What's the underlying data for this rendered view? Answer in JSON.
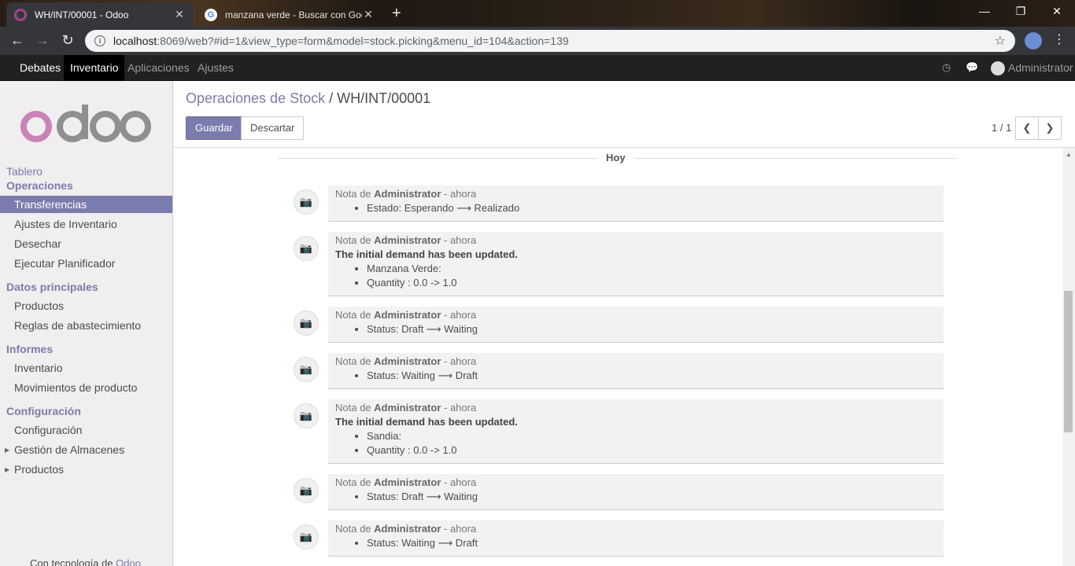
{
  "browser": {
    "tabs": [
      {
        "title": "WH/INT/00001 - Odoo",
        "active": true
      },
      {
        "title": "manzana verde - Buscar con Goo",
        "active": false
      }
    ],
    "url_host": "localhost",
    "url_rest": ":8069/web?#id=1&view_type=form&model=stock.picking&menu_id=104&action=139",
    "window_controls": {
      "minimize": "—",
      "restore": "❐",
      "close": "✕"
    }
  },
  "navbar": {
    "menus": [
      "Debates",
      "Inventario",
      "Aplicaciones",
      "Ajustes"
    ],
    "active_menu": "Inventario",
    "user": "Administrator"
  },
  "sidebar": {
    "logo_text": "odoo",
    "sections": [
      {
        "title": "Tablero"
      },
      {
        "title": "Operaciones",
        "items": [
          "Transferencias",
          "Ajustes de Inventario",
          "Desechar",
          "Ejecutar Planificador"
        ]
      },
      {
        "title": "Datos principales",
        "items": [
          "Productos",
          "Reglas de abastecimiento"
        ]
      },
      {
        "title": "Informes",
        "items": [
          "Inventario",
          "Movimientos de producto"
        ]
      },
      {
        "title": "Configuración",
        "items": [
          "Configuración",
          "Gestión de Almacenes",
          "Productos"
        ]
      }
    ],
    "active_item": "Transferencias",
    "powered_prefix": "Con tecnología de ",
    "powered_brand": "Odoo"
  },
  "control_panel": {
    "breadcrumb_parent": "Operaciones de Stock",
    "breadcrumb_sep": " / ",
    "breadcrumb_current": "WH/INT/00001",
    "save_label": "Guardar",
    "discard_label": "Descartar",
    "pager": "1 / 1"
  },
  "chatter": {
    "date_label": "Hoy",
    "messages": [
      {
        "prefix": "Nota de ",
        "author": "Administrator",
        "time": " - ahora",
        "bullets": [
          "Estado: Esperando ⟶ Realizado"
        ]
      },
      {
        "prefix": "Nota de ",
        "author": "Administrator",
        "time": " - ahora",
        "headline": "The initial demand has been updated.",
        "bullets": [
          "Manzana Verde:",
          "Quantity : 0.0 -> 1.0"
        ]
      },
      {
        "prefix": "Nota de ",
        "author": "Administrator",
        "time": " - ahora",
        "bullets": [
          "Status: Draft ⟶ Waiting"
        ]
      },
      {
        "prefix": "Nota de ",
        "author": "Administrator",
        "time": " - ahora",
        "bullets": [
          "Status: Waiting ⟶ Draft"
        ]
      },
      {
        "prefix": "Nota de ",
        "author": "Administrator",
        "time": " - ahora",
        "headline": "The initial demand has been updated.",
        "bullets": [
          "Sandia:",
          "Quantity : 0.0 -> 1.0"
        ]
      },
      {
        "prefix": "Nota de ",
        "author": "Administrator",
        "time": " - ahora",
        "bullets": [
          "Status: Draft ⟶ Waiting"
        ]
      },
      {
        "prefix": "Nota de ",
        "author": "Administrator",
        "time": " - ahora",
        "bullets": [
          "Status: Waiting ⟶ Draft"
        ]
      }
    ]
  },
  "colors": {
    "odoo_purple": "#7c7bad",
    "navbar": "#212121",
    "logo_o": "#c983b7",
    "logo_doo": "#8f8f8f"
  }
}
